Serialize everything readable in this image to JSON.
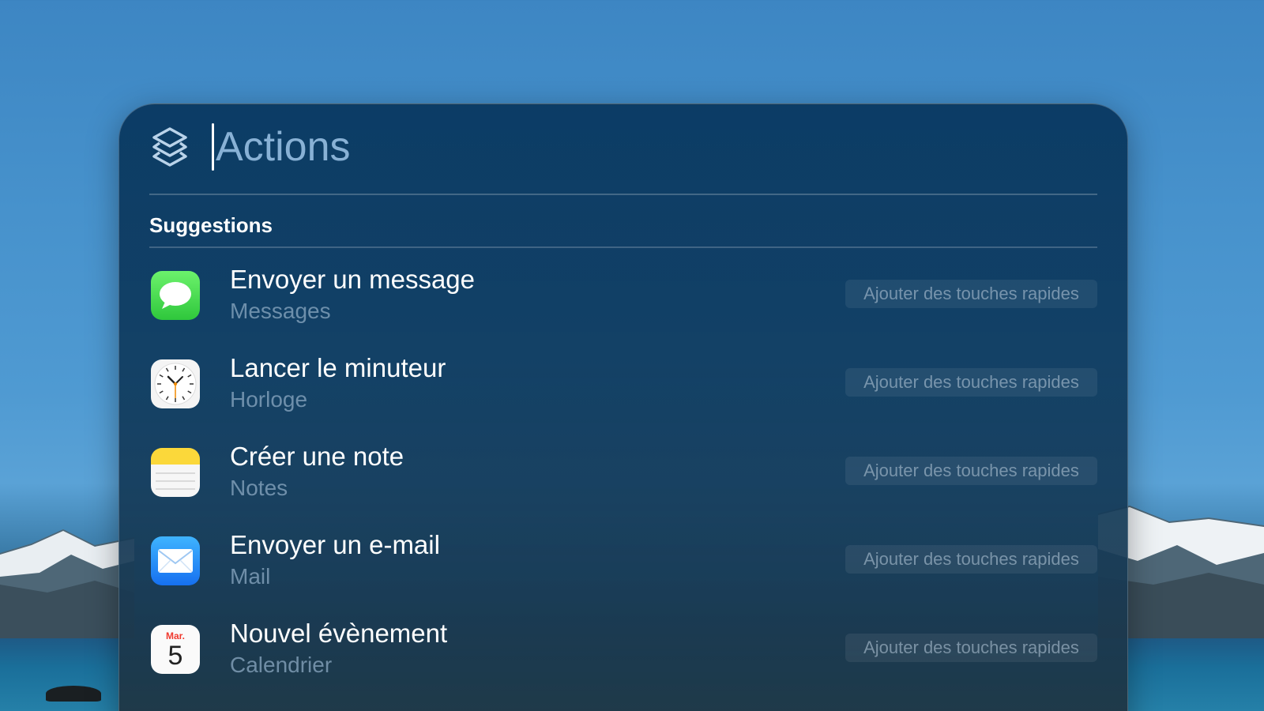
{
  "search": {
    "placeholder": "Actions",
    "value": ""
  },
  "section": {
    "title": "Suggestions"
  },
  "items": [
    {
      "title": "Envoyer un message",
      "app": "Messages",
      "icon": "messages-icon",
      "button": "Ajouter des touches rapides"
    },
    {
      "title": "Lancer le minuteur",
      "app": "Horloge",
      "icon": "clock-icon",
      "button": "Ajouter des touches rapides"
    },
    {
      "title": "Créer une note",
      "app": "Notes",
      "icon": "notes-icon",
      "button": "Ajouter des touches rapides"
    },
    {
      "title": "Envoyer un e-mail",
      "app": "Mail",
      "icon": "mail-icon",
      "button": "Ajouter des touches rapides"
    },
    {
      "title": "Nouvel évènement",
      "app": "Calendrier",
      "icon": "calendar-icon",
      "button": "Ajouter des touches rapides",
      "calendar_month": "Mar.",
      "calendar_day": "5"
    }
  ],
  "colors": {
    "panel": "#0d3b62",
    "accent_green": "#2fc73c",
    "accent_blue": "#1670f0"
  }
}
